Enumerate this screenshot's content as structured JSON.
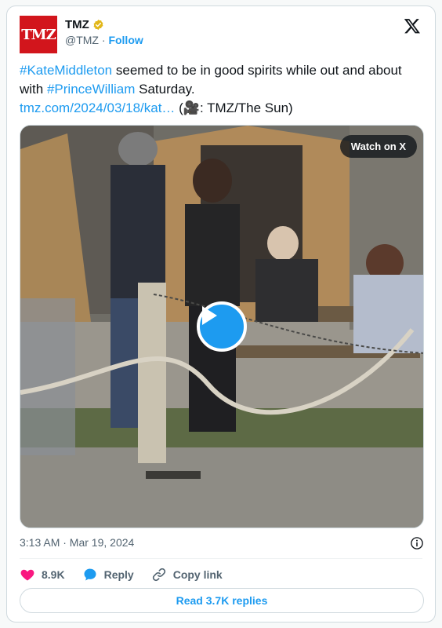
{
  "author": {
    "avatar_text": "TMZ",
    "display_name": "TMZ",
    "handle": "@TMZ",
    "separator": "·",
    "follow_label": "Follow",
    "verified": true,
    "brand_color": "#d2151c"
  },
  "tweet": {
    "hashtag1": "#KateMiddleton",
    "text1": " seemed to be in good spirits while out and about with ",
    "hashtag2": "#PrinceWilliam",
    "text2": " Saturday.",
    "link": "tmz.com/2024/03/18/kat…",
    "credit_open": " (",
    "credit_icon": "🎥",
    "credit_text": ": TMZ/The Sun)"
  },
  "media": {
    "watch_label": "Watch on X",
    "play_icon": "play-icon"
  },
  "meta": {
    "timestamp": "3:13 AM · Mar 19, 2024"
  },
  "actions": {
    "like_count": "8.9K",
    "reply_label": "Reply",
    "copy_link_label": "Copy link"
  },
  "read_replies_label": "Read 3.7K replies",
  "colors": {
    "accent": "#1d9bf0",
    "like": "#f91880",
    "verified_gold": "#e2b719"
  }
}
